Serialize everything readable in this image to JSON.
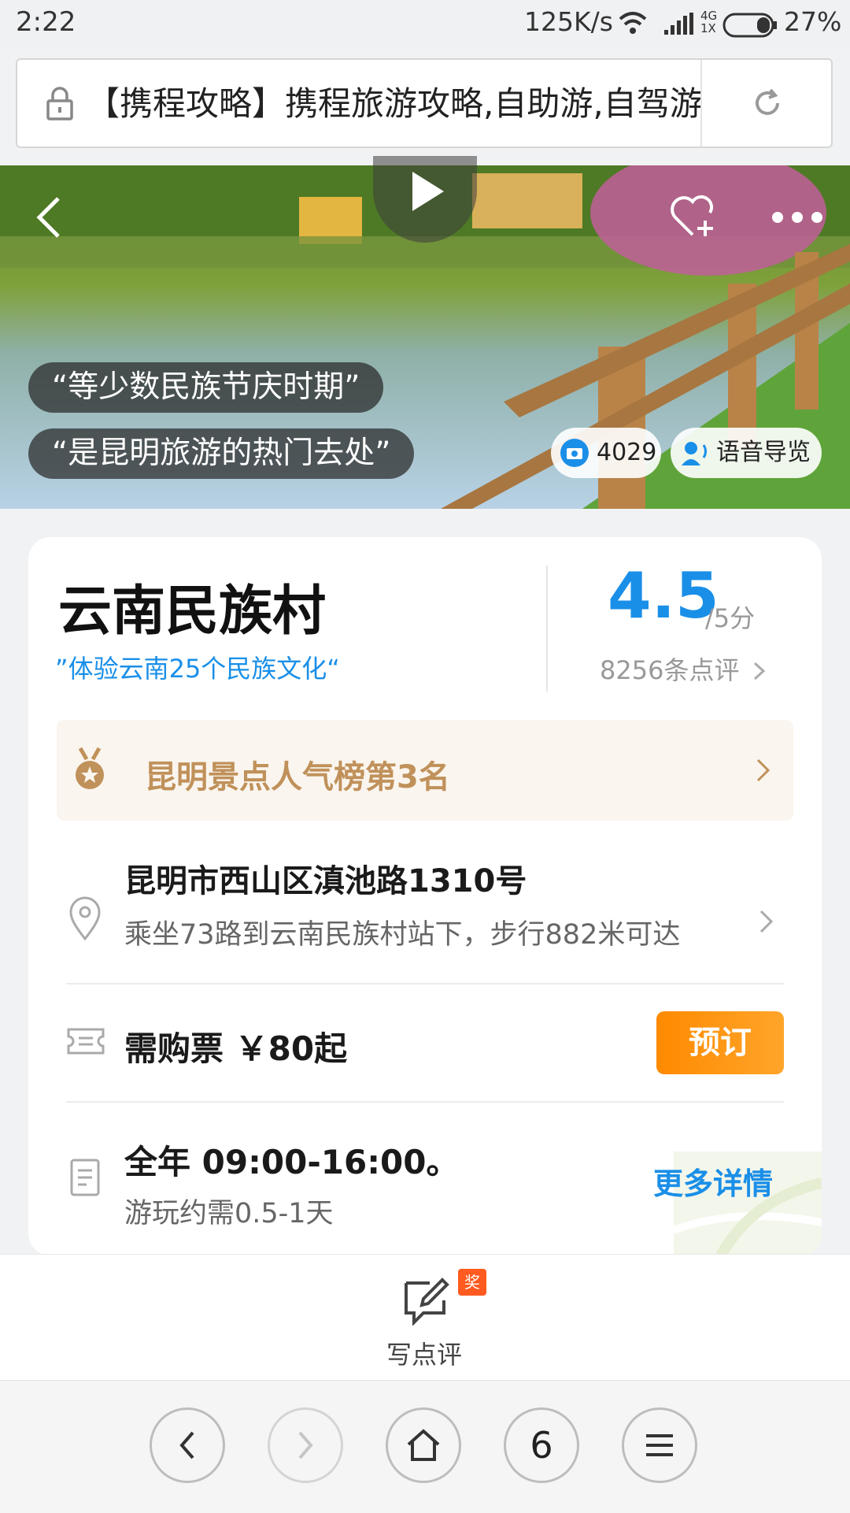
{
  "status_bar": {
    "time": "2:22",
    "speed": "125K/s",
    "network": "4G",
    "network_sub": "1X",
    "battery": "27%"
  },
  "url_bar": {
    "text": "【携程攻略】携程旅游攻略,自助游,自驾游"
  },
  "hero": {
    "quote1": "“等少数民族节庆时期”",
    "quote2": "“是昆明旅游的热门去处”",
    "photo_count": "4029",
    "audio_guide": "语音导览"
  },
  "attraction": {
    "name": "云南民族村",
    "tagline": "”体验云南25个民族文化“",
    "score": "4.5",
    "score_max": "/5分",
    "review_count": "8256条点评",
    "rank": "昆明景点人气榜第3名",
    "address": "昆明市西山区滇池路1310号",
    "transit": "乘坐73路到云南民族村站下，步行882米可达",
    "ticket": "需购票 ￥80起",
    "book_label": "预订",
    "hours": "全年 09:00-16:00。",
    "duration": "游玩约需0.5-1天",
    "more_details": "更多详情"
  },
  "review_bar": {
    "badge": "奖",
    "label": "写点评"
  },
  "browser_nav": {
    "tab_count": "6"
  }
}
